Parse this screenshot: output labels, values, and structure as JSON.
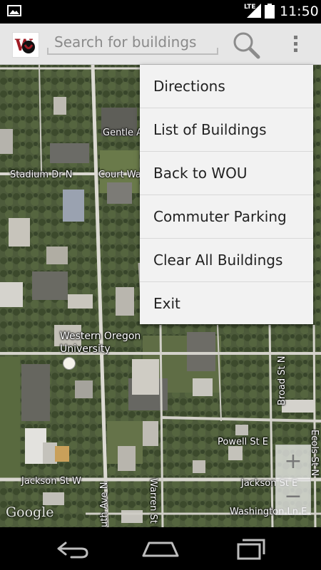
{
  "status_bar": {
    "network": "LTE",
    "time": "11:50",
    "icons": [
      "image-notification-icon",
      "signal-icon",
      "battery-icon"
    ]
  },
  "action_bar": {
    "logo_icon": "wou-logo-icon",
    "search_placeholder": "Search for buildings",
    "search_icon": "search-icon",
    "overflow_icon": "overflow-menu-icon"
  },
  "menu": {
    "items": [
      {
        "label": "Directions"
      },
      {
        "label": "List of Buildings"
      },
      {
        "label": "Back to WOU"
      },
      {
        "label": "Commuter Parking"
      },
      {
        "label": "Clear All Buildings"
      },
      {
        "label": "Exit"
      }
    ]
  },
  "map": {
    "labels": {
      "gentle_ave": "Gentle Av",
      "stadium_dr": "Stadium Dr N",
      "court_way": "Court Wa",
      "university_1": "Western Oregon",
      "university_2": "University",
      "monmouth_ave": "Monmouth Ave N",
      "warren_st": "Warren St N",
      "broad_st": "Broad St N",
      "powell_st": "Powell St E",
      "jackson_st_w": "Jackson St W",
      "jackson_st_e": "Jackson St E",
      "washington": "Washington Ln E",
      "ecols": "Ecols St N"
    },
    "attribution": "Google",
    "zoom_in": "+",
    "zoom_out": "−"
  },
  "nav_bar": {
    "back_icon": "back-icon",
    "home_icon": "home-icon",
    "recents_icon": "recent-apps-icon"
  }
}
